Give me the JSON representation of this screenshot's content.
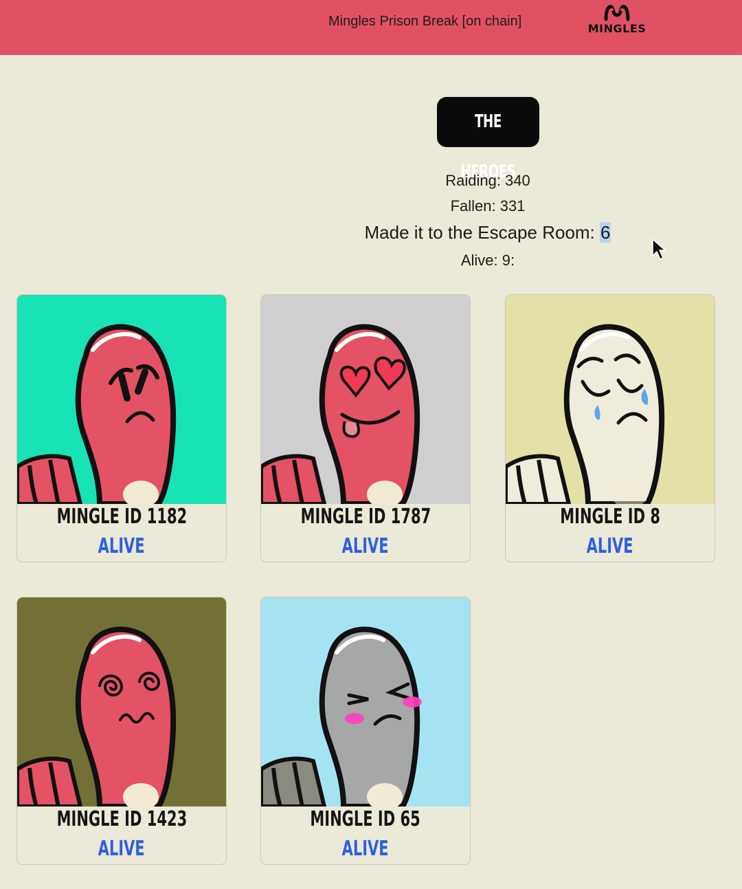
{
  "header": {
    "title": "Mingles Prison Break [on chain]",
    "logo_text": "MINGLES",
    "logo_icon": "mingles-logo-icon",
    "bar_color": "#e05164"
  },
  "section": {
    "heading": "THE HEROES"
  },
  "stats": {
    "raiding": "Raiding: 340",
    "fallen": "Fallen: 331",
    "escape_label": "Made it to the Escape Room: ",
    "escape_value": "6",
    "alive": "Alive: 9:"
  },
  "colors": {
    "alive_status": "#2f5fe0",
    "selection_highlight": "#b8d3f1"
  },
  "cards": [
    {
      "name": "MINGLE ID 1182",
      "status": "ALIVE",
      "bg": "#17e3b4",
      "skin": "#e35265",
      "expression": "worried"
    },
    {
      "name": "MINGLE ID 1787",
      "status": "ALIVE",
      "bg": "#cfcfcf",
      "skin": "#e35265",
      "expression": "heart-eyes"
    },
    {
      "name": "MINGLE ID 8",
      "status": "ALIVE",
      "bg": "#e4e1a8",
      "skin": "#f0ecdc",
      "expression": "crying"
    },
    {
      "name": "MINGLE ID 1423",
      "status": "ALIVE",
      "bg": "#737035",
      "skin": "#e35265",
      "expression": "dizzy"
    },
    {
      "name": "MINGLE ID 65",
      "status": "ALIVE",
      "bg": "#a5e3f3",
      "skin": "#a6a8a7",
      "expression": "robot-blush"
    }
  ]
}
